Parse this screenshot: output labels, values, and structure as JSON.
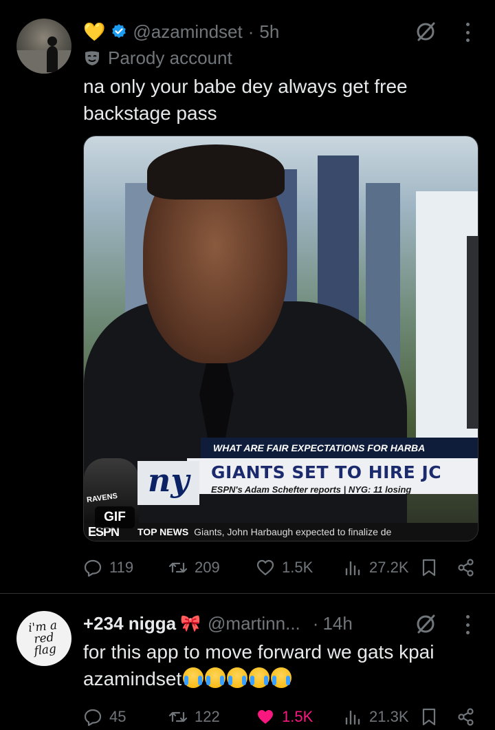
{
  "tweets": [
    {
      "avatar": "sunset-silhouette-avatar",
      "badge_emoji": "💛",
      "handle": "@azamindset",
      "separator": "·",
      "time": "5h",
      "parody_label": "Parody account",
      "text": "na only your babe dey always get free backstage pass",
      "media": {
        "type": "GIF",
        "gif_label": "GIF",
        "question_bar": "WHAT ARE FAIR EXPECTATIONS FOR HARBA",
        "headline": "GIANTS SET TO HIRE JC",
        "subline": "ESPN's Adam Schefter reports | NYG: 11 losing",
        "logo_text": "ny",
        "coach_label": "RAVENS",
        "network": "ESPN",
        "ticker_label": "TOP NEWS",
        "ticker_text": "Giants, John Harbaugh expected to finalize de"
      },
      "stats": {
        "replies": "119",
        "reposts": "209",
        "likes": "1.5K",
        "views": "27.2K"
      }
    },
    {
      "avatar_text": "i'm a red flag",
      "display_name": "+234 nigga",
      "name_emoji": "🎀",
      "handle": "@martinn...",
      "separator": "·",
      "time": "14h",
      "text_line1": "for this app to move forward we gats kpai",
      "text_line2": "azamindset",
      "stats": {
        "replies": "45",
        "reposts": "122",
        "likes": "1.5K",
        "views": "21.3K"
      }
    }
  ],
  "colors": {
    "background": "#000000",
    "text": "#e7e9ea",
    "secondary": "#71767b",
    "like_active": "#f91880",
    "verified": "#1d9bf0"
  }
}
